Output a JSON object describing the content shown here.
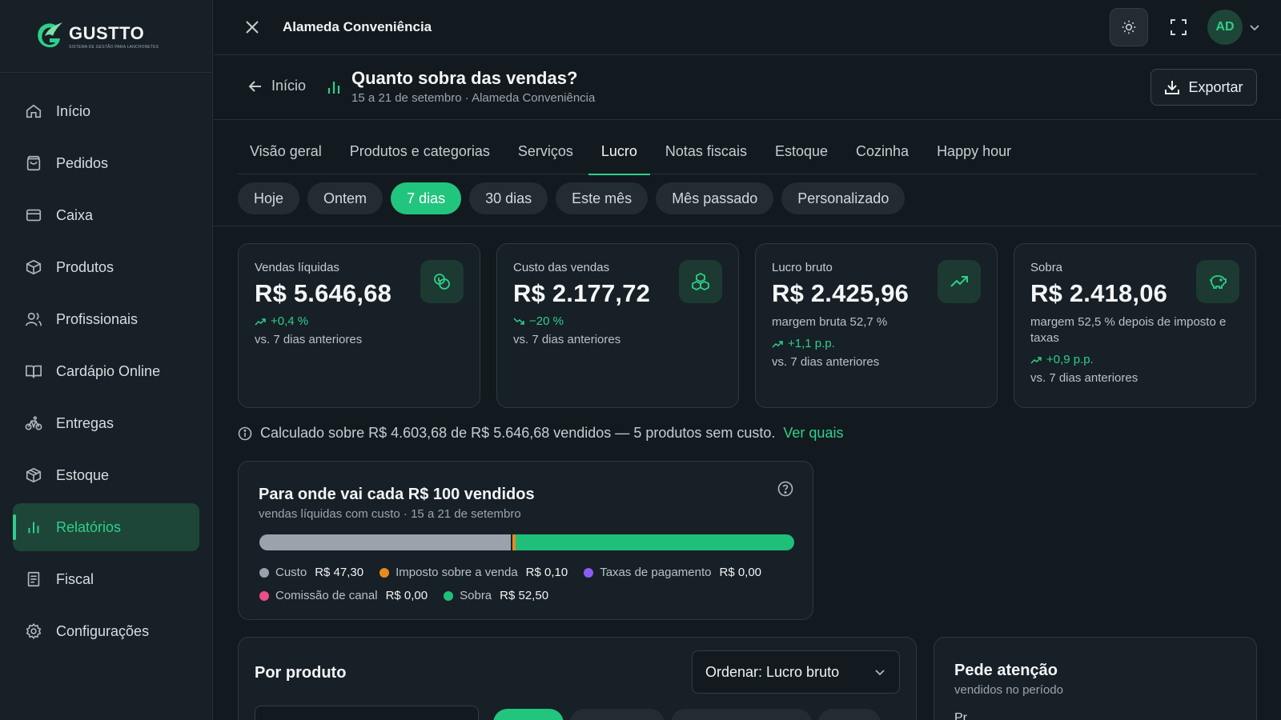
{
  "brand": {
    "name": "GUSTTO",
    "tagline": "SISTEMA DE GESTÃO PARA LANCHONETES"
  },
  "sidebar": {
    "items": [
      {
        "label": "Início",
        "icon": "home-icon"
      },
      {
        "label": "Pedidos",
        "icon": "bag-icon"
      },
      {
        "label": "Caixa",
        "icon": "card-icon"
      },
      {
        "label": "Produtos",
        "icon": "box-icon"
      },
      {
        "label": "Profissionais",
        "icon": "users-icon"
      },
      {
        "label": "Cardápio Online",
        "icon": "book-icon"
      },
      {
        "label": "Entregas",
        "icon": "bike-icon"
      },
      {
        "label": "Estoque",
        "icon": "package-icon"
      },
      {
        "label": "Relatórios",
        "icon": "bar-chart-icon",
        "active": true
      },
      {
        "label": "Fiscal",
        "icon": "receipt-icon"
      },
      {
        "label": "Configurações",
        "icon": "gear-icon"
      }
    ]
  },
  "topbar": {
    "store_name": "Alameda Conveniência",
    "avatar_initials": "AD"
  },
  "header": {
    "back_label": "Início",
    "title": "Quanto sobra das vendas?",
    "subtitle": "15 a 21 de setembro · Alameda Conveniência",
    "export_label": "Exportar"
  },
  "tabs": [
    "Visão geral",
    "Produtos e categorias",
    "Serviços",
    "Lucro",
    "Notas fiscais",
    "Estoque",
    "Cozinha",
    "Happy hour"
  ],
  "active_tab": "Lucro",
  "periods": [
    "Hoje",
    "Ontem",
    "7 dias",
    "30 dias",
    "Este mês",
    "Mês passado",
    "Personalizado"
  ],
  "active_period": "7 dias",
  "kpis": [
    {
      "label": "Vendas líquidas",
      "value": "R$ 5.646,68",
      "margin": "",
      "delta": "+0,4 %",
      "delta_dir": "up",
      "compare": "vs. 7 dias anteriores",
      "icon": "coins-icon"
    },
    {
      "label": "Custo das vendas",
      "value": "R$ 2.177,72",
      "margin": "",
      "delta": "−20 %",
      "delta_dir": "down",
      "compare": "vs. 7 dias anteriores",
      "icon": "boxes-icon"
    },
    {
      "label": "Lucro bruto",
      "value": "R$ 2.425,96",
      "margin": "margem bruta 52,7 %",
      "delta": "+1,1 p.p.",
      "delta_dir": "up",
      "compare": "vs. 7 dias anteriores",
      "icon": "trending-up-icon"
    },
    {
      "label": "Sobra",
      "value": "R$ 2.418,06",
      "margin": "margem 52,5 % depois de imposto e taxas",
      "delta": "+0,9 p.p.",
      "delta_dir": "up",
      "compare": "vs. 7 dias anteriores",
      "icon": "piggy-bank-icon"
    }
  ],
  "calc_note": {
    "text": "Calculado sobre R$ 4.603,68 de R$ 5.646,68 vendidos — 5 produtos sem custo.",
    "link": "Ver quais"
  },
  "breakdown": {
    "title": "Para onde vai cada R$ 100 vendidos",
    "subtitle": "vendas líquidas com custo · 15 a 21 de setembro",
    "segments": [
      {
        "name": "Custo",
        "value": "R$ 47,30",
        "amount": 47.3,
        "color": "#9aa3ab"
      },
      {
        "name": "Imposto sobre a venda",
        "value": "R$ 0,10",
        "amount": 0.1,
        "color": "#e58a1f"
      },
      {
        "name": "Taxas de pagamento",
        "value": "R$ 0,00",
        "amount": 0.0,
        "color": "#8b5cf6"
      },
      {
        "name": "Comissão de canal",
        "value": "R$ 0,00",
        "amount": 0.0,
        "color": "#ec4f87"
      },
      {
        "name": "Sobra",
        "value": "R$ 52,50",
        "amount": 52.5,
        "color": "#1fbf7a"
      }
    ]
  },
  "by_product": {
    "title": "Por produto",
    "sort_label": "Ordenar: Lucro bruto"
  },
  "attention": {
    "title": "Pede atenção",
    "subtitle": "vendidos no período",
    "cut_text": "Pr..."
  }
}
